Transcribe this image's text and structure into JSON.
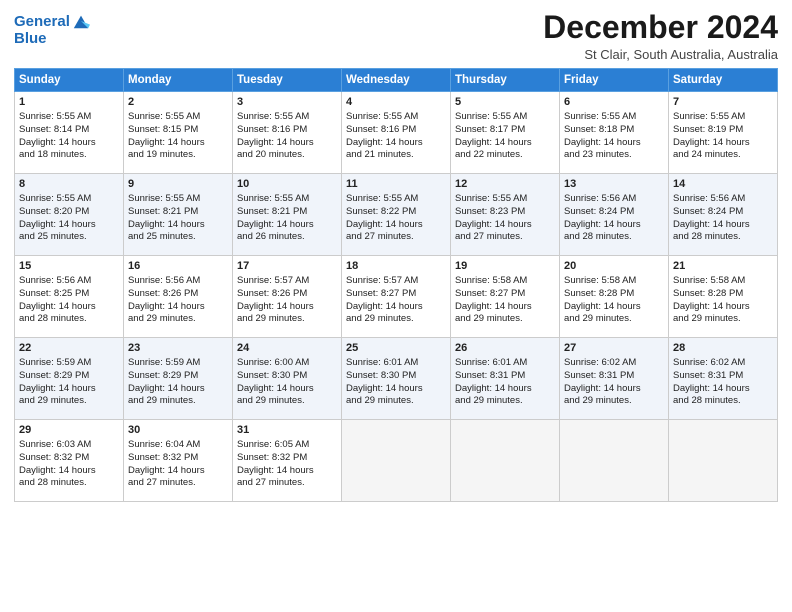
{
  "logo": {
    "line1": "General",
    "line2": "Blue"
  },
  "title": "December 2024",
  "subtitle": "St Clair, South Australia, Australia",
  "days_of_week": [
    "Sunday",
    "Monday",
    "Tuesday",
    "Wednesday",
    "Thursday",
    "Friday",
    "Saturday"
  ],
  "weeks": [
    [
      {
        "day": 1,
        "lines": [
          "Sunrise: 5:55 AM",
          "Sunset: 8:14 PM",
          "Daylight: 14 hours",
          "and 18 minutes."
        ]
      },
      {
        "day": 2,
        "lines": [
          "Sunrise: 5:55 AM",
          "Sunset: 8:15 PM",
          "Daylight: 14 hours",
          "and 19 minutes."
        ]
      },
      {
        "day": 3,
        "lines": [
          "Sunrise: 5:55 AM",
          "Sunset: 8:16 PM",
          "Daylight: 14 hours",
          "and 20 minutes."
        ]
      },
      {
        "day": 4,
        "lines": [
          "Sunrise: 5:55 AM",
          "Sunset: 8:16 PM",
          "Daylight: 14 hours",
          "and 21 minutes."
        ]
      },
      {
        "day": 5,
        "lines": [
          "Sunrise: 5:55 AM",
          "Sunset: 8:17 PM",
          "Daylight: 14 hours",
          "and 22 minutes."
        ]
      },
      {
        "day": 6,
        "lines": [
          "Sunrise: 5:55 AM",
          "Sunset: 8:18 PM",
          "Daylight: 14 hours",
          "and 23 minutes."
        ]
      },
      {
        "day": 7,
        "lines": [
          "Sunrise: 5:55 AM",
          "Sunset: 8:19 PM",
          "Daylight: 14 hours",
          "and 24 minutes."
        ]
      }
    ],
    [
      {
        "day": 8,
        "lines": [
          "Sunrise: 5:55 AM",
          "Sunset: 8:20 PM",
          "Daylight: 14 hours",
          "and 25 minutes."
        ]
      },
      {
        "day": 9,
        "lines": [
          "Sunrise: 5:55 AM",
          "Sunset: 8:21 PM",
          "Daylight: 14 hours",
          "and 25 minutes."
        ]
      },
      {
        "day": 10,
        "lines": [
          "Sunrise: 5:55 AM",
          "Sunset: 8:21 PM",
          "Daylight: 14 hours",
          "and 26 minutes."
        ]
      },
      {
        "day": 11,
        "lines": [
          "Sunrise: 5:55 AM",
          "Sunset: 8:22 PM",
          "Daylight: 14 hours",
          "and 27 minutes."
        ]
      },
      {
        "day": 12,
        "lines": [
          "Sunrise: 5:55 AM",
          "Sunset: 8:23 PM",
          "Daylight: 14 hours",
          "and 27 minutes."
        ]
      },
      {
        "day": 13,
        "lines": [
          "Sunrise: 5:56 AM",
          "Sunset: 8:24 PM",
          "Daylight: 14 hours",
          "and 28 minutes."
        ]
      },
      {
        "day": 14,
        "lines": [
          "Sunrise: 5:56 AM",
          "Sunset: 8:24 PM",
          "Daylight: 14 hours",
          "and 28 minutes."
        ]
      }
    ],
    [
      {
        "day": 15,
        "lines": [
          "Sunrise: 5:56 AM",
          "Sunset: 8:25 PM",
          "Daylight: 14 hours",
          "and 28 minutes."
        ]
      },
      {
        "day": 16,
        "lines": [
          "Sunrise: 5:56 AM",
          "Sunset: 8:26 PM",
          "Daylight: 14 hours",
          "and 29 minutes."
        ]
      },
      {
        "day": 17,
        "lines": [
          "Sunrise: 5:57 AM",
          "Sunset: 8:26 PM",
          "Daylight: 14 hours",
          "and 29 minutes."
        ]
      },
      {
        "day": 18,
        "lines": [
          "Sunrise: 5:57 AM",
          "Sunset: 8:27 PM",
          "Daylight: 14 hours",
          "and 29 minutes."
        ]
      },
      {
        "day": 19,
        "lines": [
          "Sunrise: 5:58 AM",
          "Sunset: 8:27 PM",
          "Daylight: 14 hours",
          "and 29 minutes."
        ]
      },
      {
        "day": 20,
        "lines": [
          "Sunrise: 5:58 AM",
          "Sunset: 8:28 PM",
          "Daylight: 14 hours",
          "and 29 minutes."
        ]
      },
      {
        "day": 21,
        "lines": [
          "Sunrise: 5:58 AM",
          "Sunset: 8:28 PM",
          "Daylight: 14 hours",
          "and 29 minutes."
        ]
      }
    ],
    [
      {
        "day": 22,
        "lines": [
          "Sunrise: 5:59 AM",
          "Sunset: 8:29 PM",
          "Daylight: 14 hours",
          "and 29 minutes."
        ]
      },
      {
        "day": 23,
        "lines": [
          "Sunrise: 5:59 AM",
          "Sunset: 8:29 PM",
          "Daylight: 14 hours",
          "and 29 minutes."
        ]
      },
      {
        "day": 24,
        "lines": [
          "Sunrise: 6:00 AM",
          "Sunset: 8:30 PM",
          "Daylight: 14 hours",
          "and 29 minutes."
        ]
      },
      {
        "day": 25,
        "lines": [
          "Sunrise: 6:01 AM",
          "Sunset: 8:30 PM",
          "Daylight: 14 hours",
          "and 29 minutes."
        ]
      },
      {
        "day": 26,
        "lines": [
          "Sunrise: 6:01 AM",
          "Sunset: 8:31 PM",
          "Daylight: 14 hours",
          "and 29 minutes."
        ]
      },
      {
        "day": 27,
        "lines": [
          "Sunrise: 6:02 AM",
          "Sunset: 8:31 PM",
          "Daylight: 14 hours",
          "and 29 minutes."
        ]
      },
      {
        "day": 28,
        "lines": [
          "Sunrise: 6:02 AM",
          "Sunset: 8:31 PM",
          "Daylight: 14 hours",
          "and 28 minutes."
        ]
      }
    ],
    [
      {
        "day": 29,
        "lines": [
          "Sunrise: 6:03 AM",
          "Sunset: 8:32 PM",
          "Daylight: 14 hours",
          "and 28 minutes."
        ]
      },
      {
        "day": 30,
        "lines": [
          "Sunrise: 6:04 AM",
          "Sunset: 8:32 PM",
          "Daylight: 14 hours",
          "and 27 minutes."
        ]
      },
      {
        "day": 31,
        "lines": [
          "Sunrise: 6:05 AM",
          "Sunset: 8:32 PM",
          "Daylight: 14 hours",
          "and 27 minutes."
        ]
      },
      null,
      null,
      null,
      null
    ]
  ]
}
